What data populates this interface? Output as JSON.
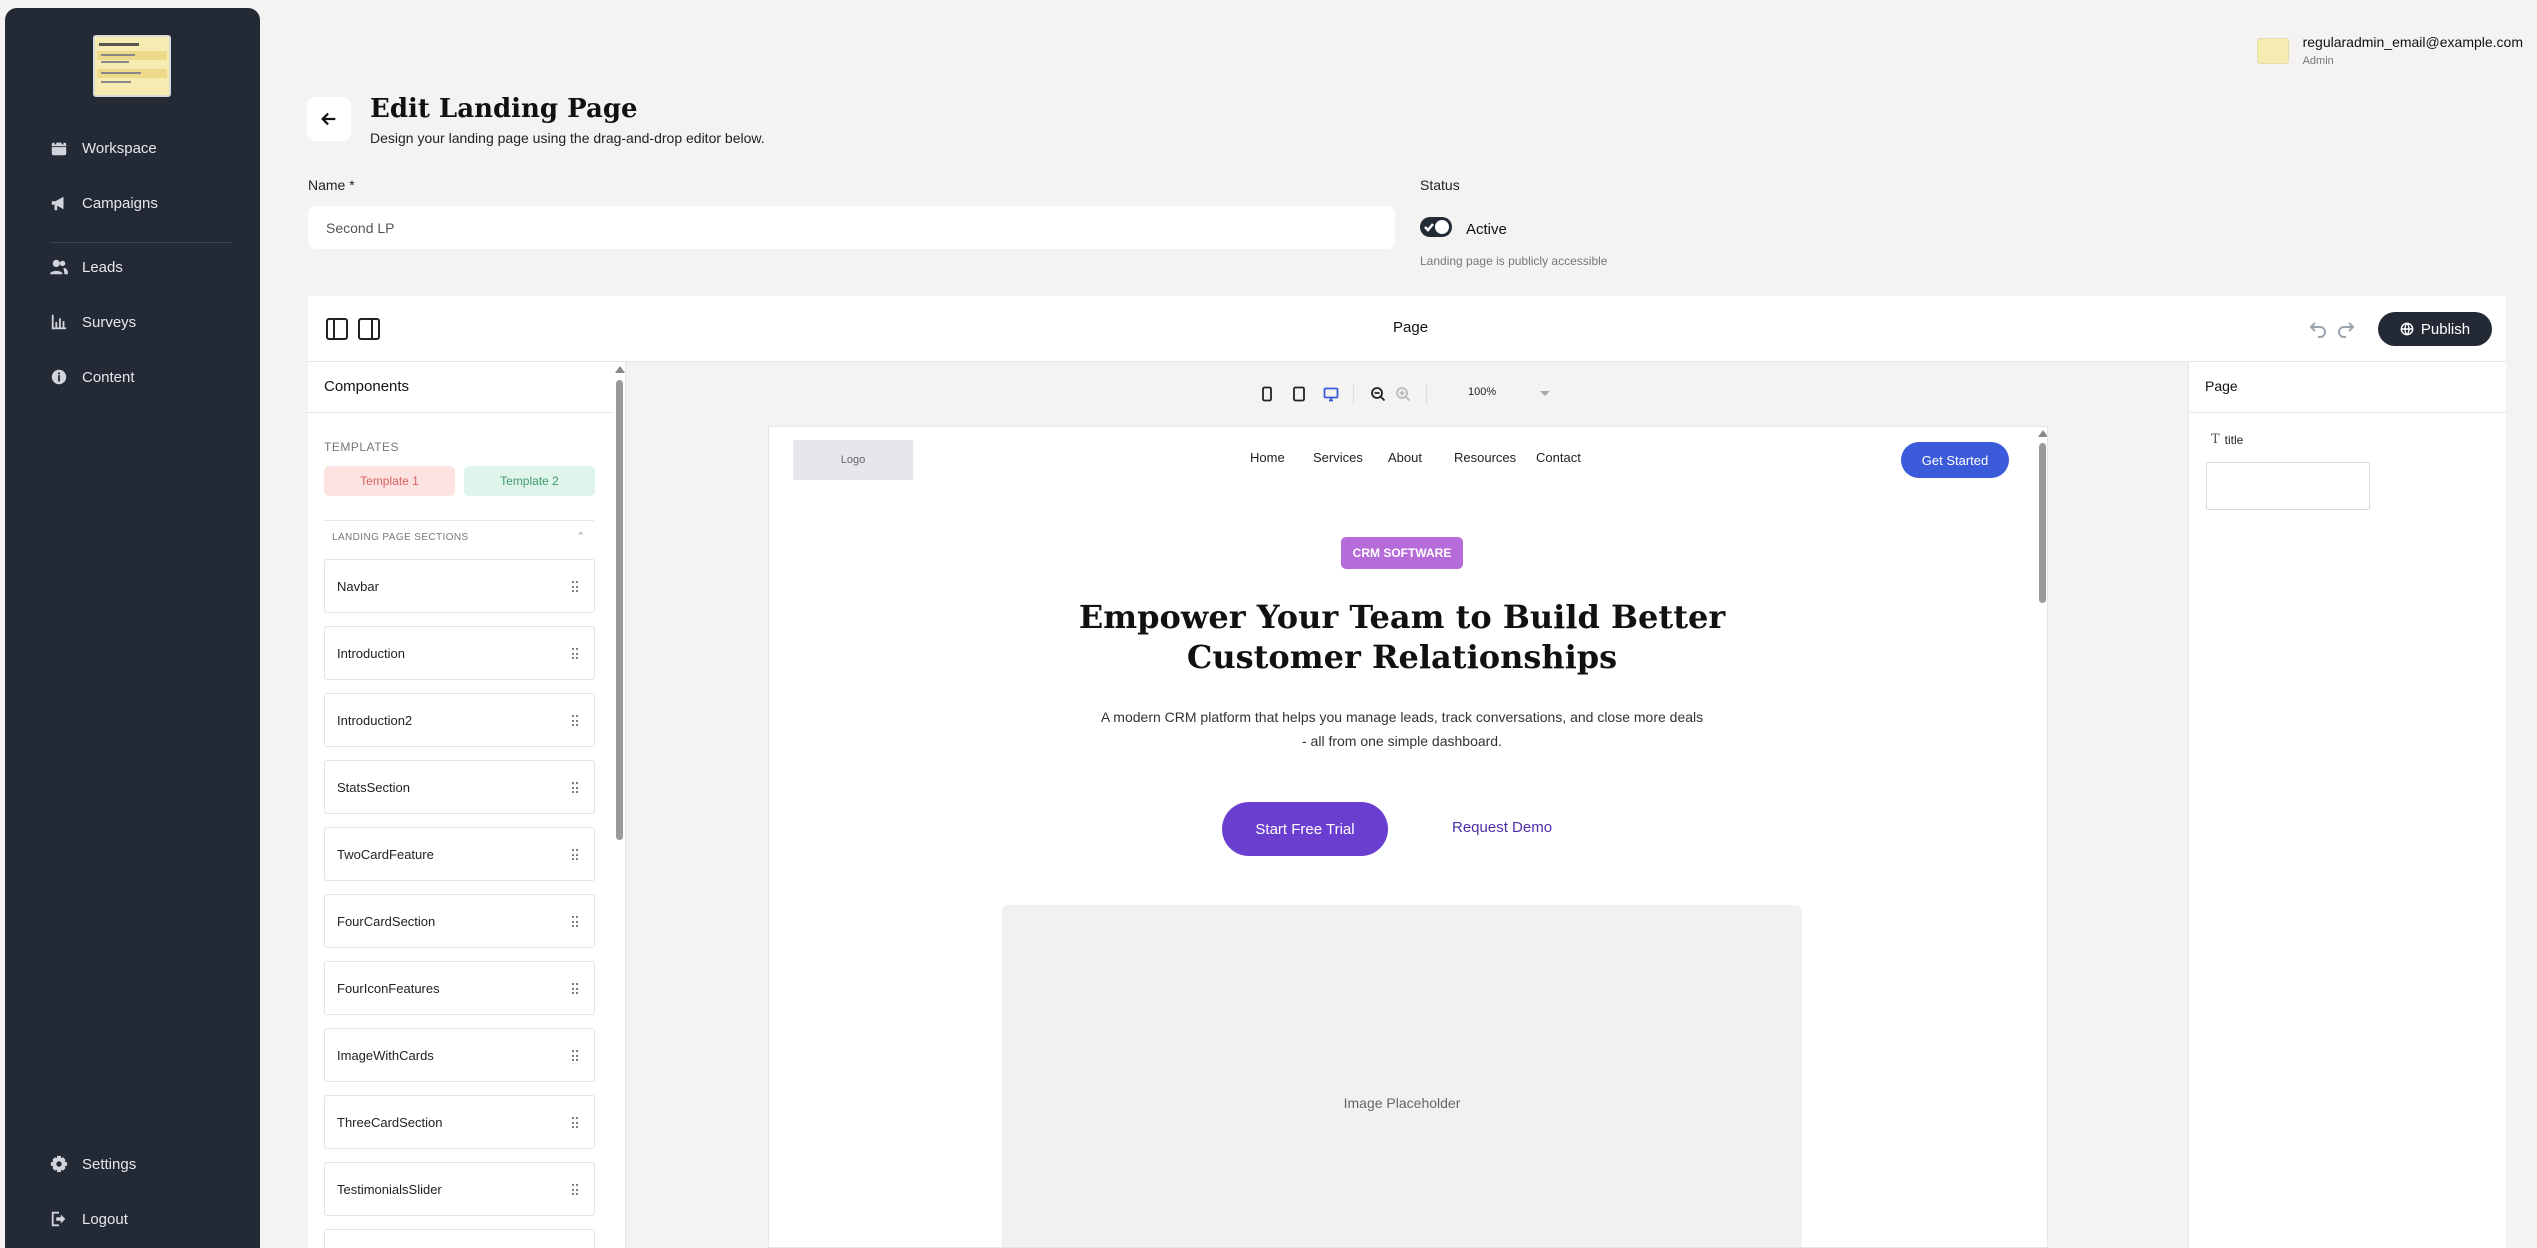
{
  "sidebar": {
    "nav": [
      {
        "label": "Workspace",
        "icon": "calendar-icon"
      },
      {
        "label": "Campaigns",
        "icon": "megaphone-icon"
      },
      {
        "label": "Leads",
        "icon": "users-icon"
      },
      {
        "label": "Surveys",
        "icon": "chart-icon"
      },
      {
        "label": "Content",
        "icon": "info-icon"
      }
    ],
    "bottom": [
      {
        "label": "Settings",
        "icon": "gear-icon"
      },
      {
        "label": "Logout",
        "icon": "logout-icon"
      }
    ]
  },
  "user": {
    "email": "regularadmin_email@example.com",
    "role": "Admin"
  },
  "header": {
    "title": "Edit Landing Page",
    "subtitle": "Design your landing page using the drag-and-drop editor below."
  },
  "form": {
    "name_label": "Name *",
    "name_value": "Second LP",
    "status_label": "Status",
    "status_value": "Active",
    "status_active": true,
    "status_hint": "Landing page is publicly accessible"
  },
  "editor": {
    "title": "Page",
    "publish_label": "Publish",
    "zoom": "100%"
  },
  "components": {
    "title": "Components",
    "templates_label": "TEMPLATES",
    "templates": [
      "Template 1",
      "Template 2"
    ],
    "sections_label": "LANDING PAGE SECTIONS",
    "sections": [
      "Navbar",
      "Introduction",
      "Introduction2",
      "StatsSection",
      "TwoCardFeature",
      "FourCardSection",
      "FourIconFeatures",
      "ImageWithCards",
      "ThreeCardSection",
      "TestimonialsSlider"
    ]
  },
  "preview": {
    "logo": "Logo",
    "nav": [
      "Home",
      "Services",
      "About",
      "Resources",
      "Contact"
    ],
    "cta": "Get Started",
    "badge": "CRM SOFTWARE",
    "heading": "Empower Your Team to Build Better Customer Relationships",
    "description": "A modern CRM platform that helps you manage leads, track conversations, and close more deals - all from one simple dashboard.",
    "primary_button": "Start Free Trial",
    "secondary_button": "Request Demo",
    "image_placeholder": "Image Placeholder"
  },
  "properties": {
    "title": "Page",
    "field_label": "title"
  },
  "colors": {
    "sidebar_bg": "#232a35",
    "accent_purple": "#6a3fd0",
    "accent_blue": "#3b5bdb",
    "badge": "#b66cd8",
    "template1_bg": "#fde2e2",
    "template2_bg": "#dff4ea"
  }
}
